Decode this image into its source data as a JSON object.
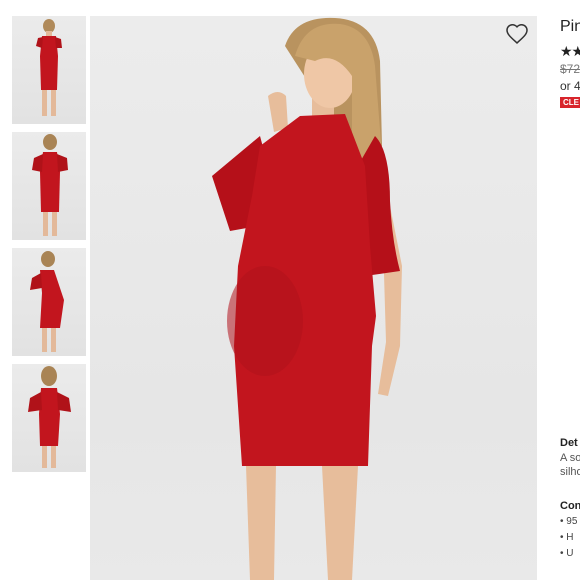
{
  "product": {
    "title": "Pin",
    "rating_stars": "★★",
    "old_price": "$72",
    "installment": "or 4",
    "badge": "CLE"
  },
  "details": {
    "heading": "Det",
    "line1": "A so",
    "line2": "silho"
  },
  "content": {
    "heading": "Con",
    "bullets": [
      "• 95",
      "• H",
      "• U"
    ]
  },
  "gallery": {
    "thumbnails": [
      "front-view",
      "back-view-halter",
      "side-view",
      "back-view"
    ],
    "dress_color": "#c2151e",
    "wishlist_icon": "heart-icon"
  }
}
